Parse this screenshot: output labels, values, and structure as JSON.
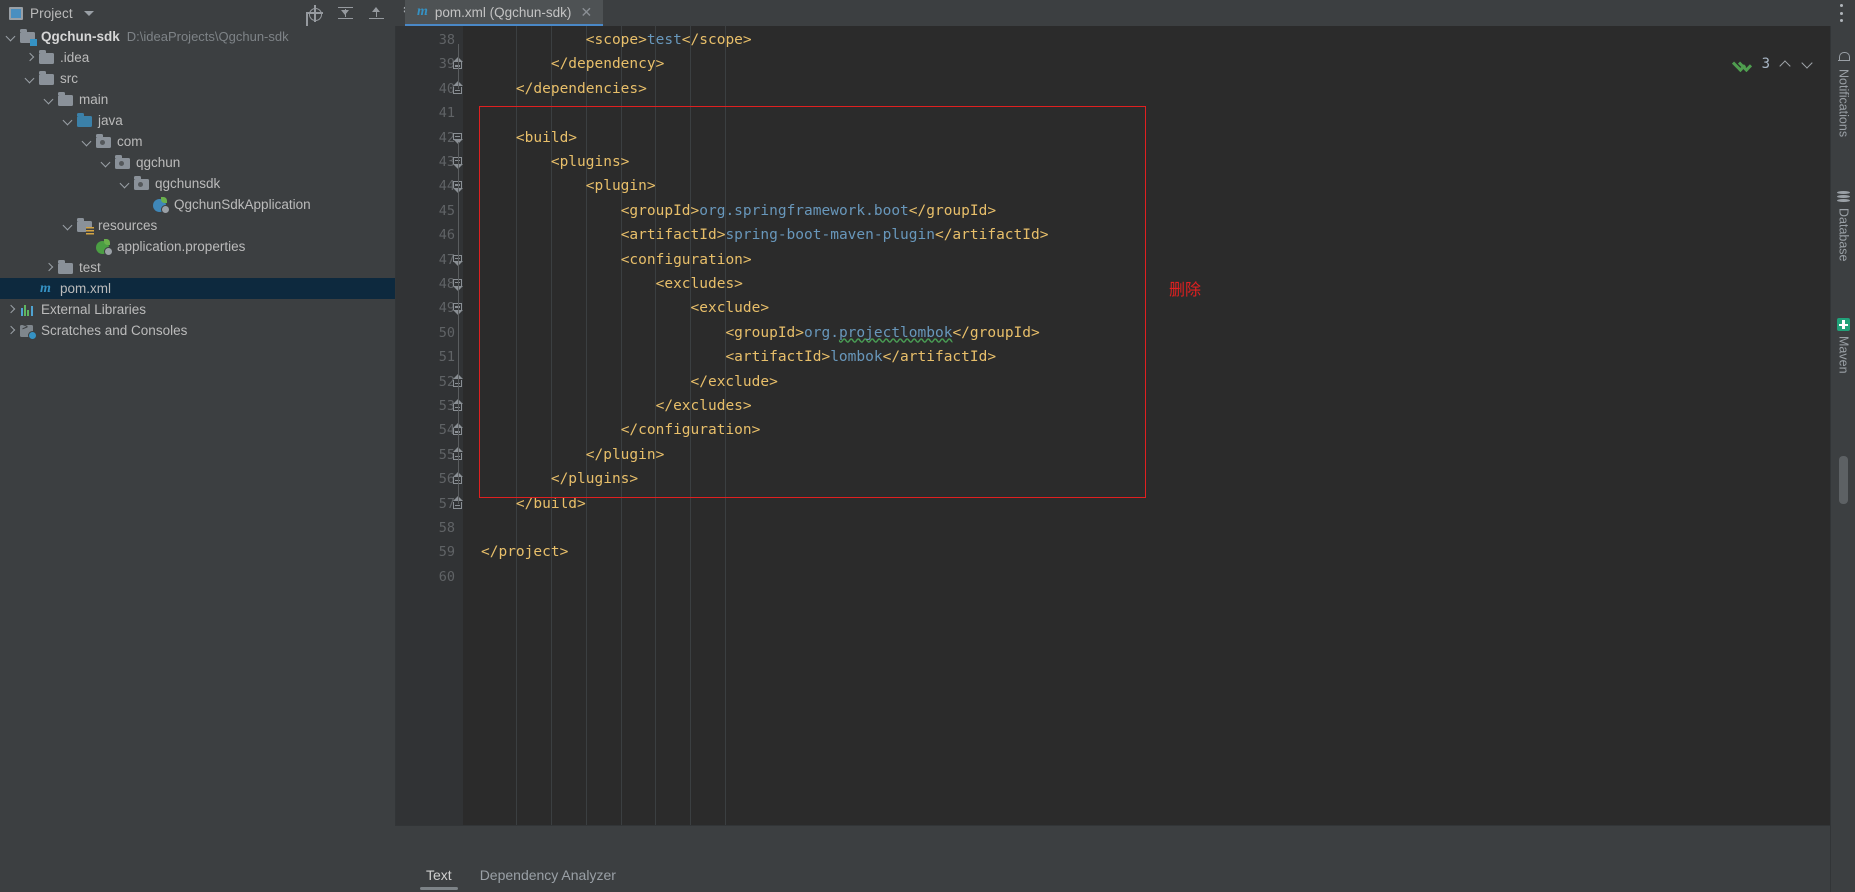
{
  "window": {
    "tool_window_title": "Project",
    "tool_window_icon": "project-panel-icon",
    "dropdown_icon": "chevron-down-icon",
    "toolbar_icons": [
      "locate-icon",
      "collapse-all-icon",
      "expand-all-icon",
      "gear-icon",
      "minimize-icon"
    ],
    "options_menu_icon": "kebab-menu-icon"
  },
  "tabs": {
    "editor_tabs": [
      {
        "icon": "maven-m-icon",
        "label": "pom.xml (Qgchun-sdk)",
        "close_icon": "close-icon",
        "active": true
      }
    ]
  },
  "tree": {
    "items": [
      {
        "label": "Qgchun-sdk",
        "path": "D:\\ideaProjects\\Qgchun-sdk",
        "depth": 0,
        "arrow": "open",
        "icon": "module-folder-icon",
        "bold": true,
        "selected": false
      },
      {
        "label": ".idea",
        "path": "",
        "depth": 1,
        "arrow": "closed",
        "icon": "folder-icon",
        "bold": false,
        "selected": false
      },
      {
        "label": "src",
        "path": "",
        "depth": 1,
        "arrow": "open",
        "icon": "folder-icon",
        "bold": false,
        "selected": false
      },
      {
        "label": "main",
        "path": "",
        "depth": 2,
        "arrow": "open",
        "icon": "folder-icon",
        "bold": false,
        "selected": false
      },
      {
        "label": "java",
        "path": "",
        "depth": 3,
        "arrow": "open",
        "icon": "source-root-folder-icon",
        "bold": false,
        "selected": false
      },
      {
        "label": "com",
        "path": "",
        "depth": 4,
        "arrow": "open",
        "icon": "package-icon",
        "bold": false,
        "selected": false
      },
      {
        "label": "qgchun",
        "path": "",
        "depth": 5,
        "arrow": "open",
        "icon": "package-icon",
        "bold": false,
        "selected": false
      },
      {
        "label": "qgchunsdk",
        "path": "",
        "depth": 6,
        "arrow": "open",
        "icon": "package-icon",
        "bold": false,
        "selected": false
      },
      {
        "label": "QgchunSdkApplication",
        "path": "",
        "depth": 7,
        "arrow": "none",
        "icon": "spring-boot-class-icon",
        "bold": false,
        "selected": false
      },
      {
        "label": "resources",
        "path": "",
        "depth": 3,
        "arrow": "open",
        "icon": "resources-root-folder-icon",
        "bold": false,
        "selected": false
      },
      {
        "label": "application.properties",
        "path": "",
        "depth": 4,
        "arrow": "none",
        "icon": "spring-properties-icon",
        "bold": false,
        "selected": false
      },
      {
        "label": "test",
        "path": "",
        "depth": 2,
        "arrow": "closed",
        "icon": "folder-icon",
        "bold": false,
        "selected": false
      },
      {
        "label": "pom.xml",
        "path": "",
        "depth": 1,
        "arrow": "none",
        "icon": "maven-m-icon",
        "bold": false,
        "selected": true
      },
      {
        "label": "External Libraries",
        "path": "",
        "depth": 0,
        "arrow": "closed",
        "icon": "libraries-icon",
        "bold": false,
        "selected": false
      },
      {
        "label": "Scratches and Consoles",
        "path": "",
        "depth": 0,
        "arrow": "closed",
        "icon": "scratches-icon",
        "bold": false,
        "selected": false
      }
    ]
  },
  "editor": {
    "first_line_number": 38,
    "lines": [
      {
        "num": 38,
        "indent": 0,
        "fold": "none",
        "tokens": [
          {
            "t": "pad",
            "s": "            "
          },
          {
            "t": "tag",
            "s": "<scope>"
          },
          {
            "t": "text",
            "s": "test"
          },
          {
            "t": "tag",
            "s": "</scope>"
          }
        ]
      },
      {
        "num": 39,
        "indent": 0,
        "fold": "up",
        "tokens": [
          {
            "t": "pad",
            "s": "        "
          },
          {
            "t": "tag",
            "s": "</dependency>"
          }
        ]
      },
      {
        "num": 40,
        "indent": 0,
        "fold": "up",
        "tokens": [
          {
            "t": "pad",
            "s": "    "
          },
          {
            "t": "tag",
            "s": "</dependencies>"
          }
        ]
      },
      {
        "num": 41,
        "indent": 0,
        "fold": "none",
        "tokens": []
      },
      {
        "num": 42,
        "indent": 0,
        "fold": "down",
        "tokens": [
          {
            "t": "pad",
            "s": "    "
          },
          {
            "t": "tag",
            "s": "<build>"
          }
        ]
      },
      {
        "num": 43,
        "indent": 0,
        "fold": "down",
        "tokens": [
          {
            "t": "pad",
            "s": "        "
          },
          {
            "t": "tag",
            "s": "<plugins>"
          }
        ]
      },
      {
        "num": 44,
        "indent": 0,
        "fold": "down",
        "tokens": [
          {
            "t": "pad",
            "s": "            "
          },
          {
            "t": "tag",
            "s": "<plugin>"
          }
        ]
      },
      {
        "num": 45,
        "indent": 0,
        "fold": "none",
        "tokens": [
          {
            "t": "pad",
            "s": "                "
          },
          {
            "t": "tag",
            "s": "<groupId>"
          },
          {
            "t": "text",
            "s": "org.springframework.boot"
          },
          {
            "t": "tag",
            "s": "</groupId>"
          }
        ]
      },
      {
        "num": 46,
        "indent": 0,
        "fold": "none",
        "tokens": [
          {
            "t": "pad",
            "s": "                "
          },
          {
            "t": "tag",
            "s": "<artifactId>"
          },
          {
            "t": "text",
            "s": "spring-boot-maven-plugin"
          },
          {
            "t": "tag",
            "s": "</artifactId>"
          }
        ]
      },
      {
        "num": 47,
        "indent": 0,
        "fold": "down",
        "tokens": [
          {
            "t": "pad",
            "s": "                "
          },
          {
            "t": "tag",
            "s": "<configuration>"
          }
        ]
      },
      {
        "num": 48,
        "indent": 0,
        "fold": "down",
        "tokens": [
          {
            "t": "pad",
            "s": "                    "
          },
          {
            "t": "tag",
            "s": "<excludes>"
          }
        ]
      },
      {
        "num": 49,
        "indent": 0,
        "fold": "down",
        "tokens": [
          {
            "t": "pad",
            "s": "                        "
          },
          {
            "t": "tag",
            "s": "<exclude>"
          }
        ]
      },
      {
        "num": 50,
        "indent": 0,
        "fold": "none",
        "tokens": [
          {
            "t": "pad",
            "s": "                            "
          },
          {
            "t": "tag",
            "s": "<groupId>"
          },
          {
            "t": "text",
            "s": "org."
          },
          {
            "t": "typo",
            "s": "projectlombok"
          },
          {
            "t": "tag",
            "s": "</groupId>"
          }
        ]
      },
      {
        "num": 51,
        "indent": 0,
        "fold": "none",
        "tokens": [
          {
            "t": "pad",
            "s": "                            "
          },
          {
            "t": "tag",
            "s": "<artifactId>"
          },
          {
            "t": "text",
            "s": "lombok"
          },
          {
            "t": "tag",
            "s": "</artifactId>"
          }
        ]
      },
      {
        "num": 52,
        "indent": 0,
        "fold": "up",
        "tokens": [
          {
            "t": "pad",
            "s": "                        "
          },
          {
            "t": "tag",
            "s": "</exclude>"
          }
        ]
      },
      {
        "num": 53,
        "indent": 0,
        "fold": "up",
        "tokens": [
          {
            "t": "pad",
            "s": "                    "
          },
          {
            "t": "tag",
            "s": "</excludes>"
          }
        ]
      },
      {
        "num": 54,
        "indent": 0,
        "fold": "up",
        "tokens": [
          {
            "t": "pad",
            "s": "                "
          },
          {
            "t": "tag",
            "s": "</configuration>"
          }
        ]
      },
      {
        "num": 55,
        "indent": 0,
        "fold": "up",
        "tokens": [
          {
            "t": "pad",
            "s": "            "
          },
          {
            "t": "tag",
            "s": "</plugin>"
          }
        ]
      },
      {
        "num": 56,
        "indent": 0,
        "fold": "up",
        "tokens": [
          {
            "t": "pad",
            "s": "        "
          },
          {
            "t": "tag",
            "s": "</plugins>"
          }
        ]
      },
      {
        "num": 57,
        "indent": 0,
        "fold": "up",
        "tokens": [
          {
            "t": "pad",
            "s": "    "
          },
          {
            "t": "tag",
            "s": "</build>"
          }
        ]
      },
      {
        "num": 58,
        "indent": 0,
        "fold": "none",
        "tokens": []
      },
      {
        "num": 59,
        "indent": 0,
        "fold": "none",
        "tokens": [
          {
            "t": "tag",
            "s": "</project>"
          }
        ]
      },
      {
        "num": 60,
        "indent": 0,
        "fold": "none",
        "tokens": []
      }
    ],
    "annotation": {
      "text": "删除",
      "color": "#e02020"
    },
    "highlight_box": {
      "color": "#e02020",
      "from_line": 42,
      "to_line": 57
    },
    "inspection": {
      "check_icon": "inspection-ok-icon",
      "count": "3",
      "prev_icon": "chevron-up-icon",
      "next_icon": "chevron-down-icon"
    }
  },
  "right_sidebar": {
    "items": [
      {
        "label": "Notifications",
        "icon": "bell-icon"
      },
      {
        "label": "Database",
        "icon": "database-icon"
      },
      {
        "label": "Maven",
        "icon": "maven-m-icon"
      }
    ]
  },
  "bottom": {
    "tabs": [
      {
        "label": "Text",
        "active": true
      },
      {
        "label": "Dependency Analyzer",
        "active": false
      }
    ]
  },
  "colors": {
    "tag": "#e8bf6a",
    "text_value": "#6897bb",
    "editor_bg": "#2b2b2b",
    "panel_bg": "#3c3f41",
    "gutter_bg": "#313335",
    "selection_bg": "#0d293e",
    "accent_blue": "#3592c4",
    "annotation_red": "#e02020",
    "typo_underline": "#499c54"
  }
}
